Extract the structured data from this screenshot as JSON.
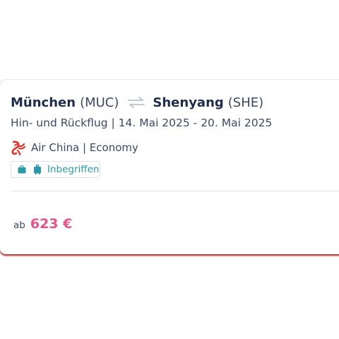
{
  "route": {
    "origin_city": "München",
    "origin_code": "(MUC)",
    "destination_city": "Shenyang",
    "destination_code": "(SHE)",
    "swap_icon": "swap-arrows-icon"
  },
  "trip": {
    "summary": "Hin- und Rückflug | 14. Mai 2025 - 20. Mai 2025"
  },
  "airline": {
    "logo_icon": "air-china-logo",
    "text": "Air China | Economy"
  },
  "baggage": {
    "icons": [
      "briefcase-icon",
      "trolley-icon"
    ],
    "label": "Inbegriffen",
    "color": "#2a9aa8"
  },
  "price": {
    "prefix": "ab",
    "value": "623 €",
    "color": "#e5528a"
  },
  "colors": {
    "text_primary": "#1f2d4d",
    "text_secondary": "#3b4866",
    "airline_red": "#e0342f",
    "card_bottom_border": "#9b1b1b"
  }
}
